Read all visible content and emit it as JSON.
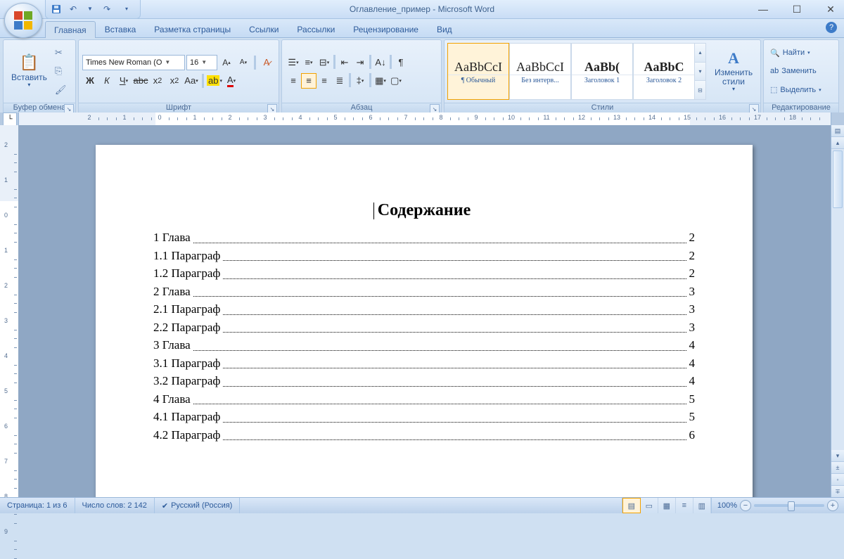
{
  "app": {
    "title": "Оглавление_пример - Microsoft Word"
  },
  "qat": {
    "save": "save",
    "undo": "undo",
    "redo": "redo"
  },
  "tabs": [
    "Главная",
    "Вставка",
    "Разметка страницы",
    "Ссылки",
    "Рассылки",
    "Рецензирование",
    "Вид"
  ],
  "activeTab": 0,
  "ribbon": {
    "clipboard": {
      "label": "Буфер обмена",
      "paste": "Вставить"
    },
    "font": {
      "label": "Шрифт",
      "name": "Times New Roman (О",
      "size": "16",
      "bold": "Ж",
      "italic": "К",
      "underline": "Ч"
    },
    "paragraph": {
      "label": "Абзац"
    },
    "styles": {
      "label": "Стили",
      "items": [
        {
          "preview": "AaBbCcI",
          "name": "¶ Обычный",
          "sel": true,
          "bold": false
        },
        {
          "preview": "AaBbCcI",
          "name": "Без интерв...",
          "sel": false,
          "bold": false
        },
        {
          "preview": "AaBb(",
          "name": "Заголовок 1",
          "sel": false,
          "bold": true
        },
        {
          "preview": "AaBbC",
          "name": "Заголовок 2",
          "sel": false,
          "bold": true
        }
      ],
      "change": "Изменить стили"
    },
    "editing": {
      "label": "Редактирование",
      "find": "Найти",
      "replace": "Заменить",
      "select": "Выделить"
    }
  },
  "document": {
    "title": "Содержание",
    "toc": [
      {
        "text": "1 Глава",
        "page": "2"
      },
      {
        "text": "1.1 Параграф",
        "page": "2"
      },
      {
        "text": "1.2 Параграф",
        "page": "2"
      },
      {
        "text": "2 Глава",
        "page": "3"
      },
      {
        "text": "2.1 Параграф",
        "page": "3"
      },
      {
        "text": "2.2 Параграф",
        "page": "3"
      },
      {
        "text": "3 Глава",
        "page": "4"
      },
      {
        "text": "3.1 Параграф",
        "page": "4"
      },
      {
        "text": "3.2 Параграф",
        "page": "4"
      },
      {
        "text": "4 Глава",
        "page": "5"
      },
      {
        "text": "4.1 Параграф",
        "page": "5"
      },
      {
        "text": "4.2 Параграф",
        "page": "6"
      }
    ]
  },
  "status": {
    "page": "Страница: 1 из 6",
    "words": "Число слов: 2 142",
    "lang": "Русский (Россия)",
    "zoom": "100%"
  }
}
